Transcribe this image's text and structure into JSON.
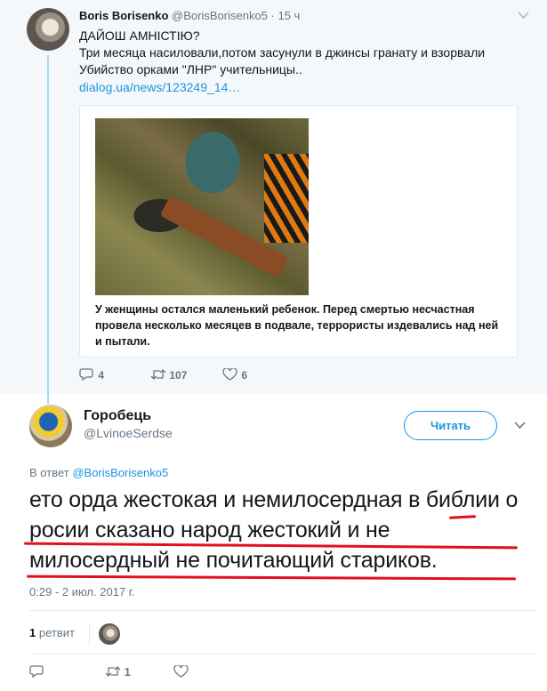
{
  "parent_tweet": {
    "name": "Boris Borisenko",
    "handle": "@BorisBorisenko5",
    "time": "15 ч",
    "line1": "ДАЙОШ АМНІСТІЮ?",
    "line2": "Три месяца насиловали,потом засунули в джинсы гранату и взорвали",
    "line3": "Убийство орками \"ЛНР\" учительницы..",
    "link": "dialog.ua/news/123249_14…",
    "card_text": "У женщины остался маленький ребенок. Перед смертью несчастная провела несколько месяцев в подвале, террористы издевались над ней и пытали.",
    "replies": "4",
    "retweets": "107",
    "likes": "6"
  },
  "tweet": {
    "name": "Горобець",
    "handle": "@LvinoeSerdse",
    "follow_label": "Читать",
    "reply_prefix": "В ответ",
    "reply_handle": "@BorisBorisenko5",
    "text": "ето орда жестокая и немилосердная в библии о росии сказано народ жестокий и не милосердный не почитающий стариков.",
    "timestamp": "0:29 - 2 июл. 2017 г.",
    "retweet_count": "1",
    "retweet_label": "ретвит",
    "replies": "",
    "retweets": "1",
    "likes": ""
  },
  "icons": {
    "reply": "reply-icon",
    "retweet": "retweet-icon",
    "like": "heart-icon",
    "caret": "chevron-down-icon"
  },
  "colors": {
    "link": "#1b95e0",
    "annotation": "#e0101a",
    "thread_line": "#a4d9f5"
  }
}
